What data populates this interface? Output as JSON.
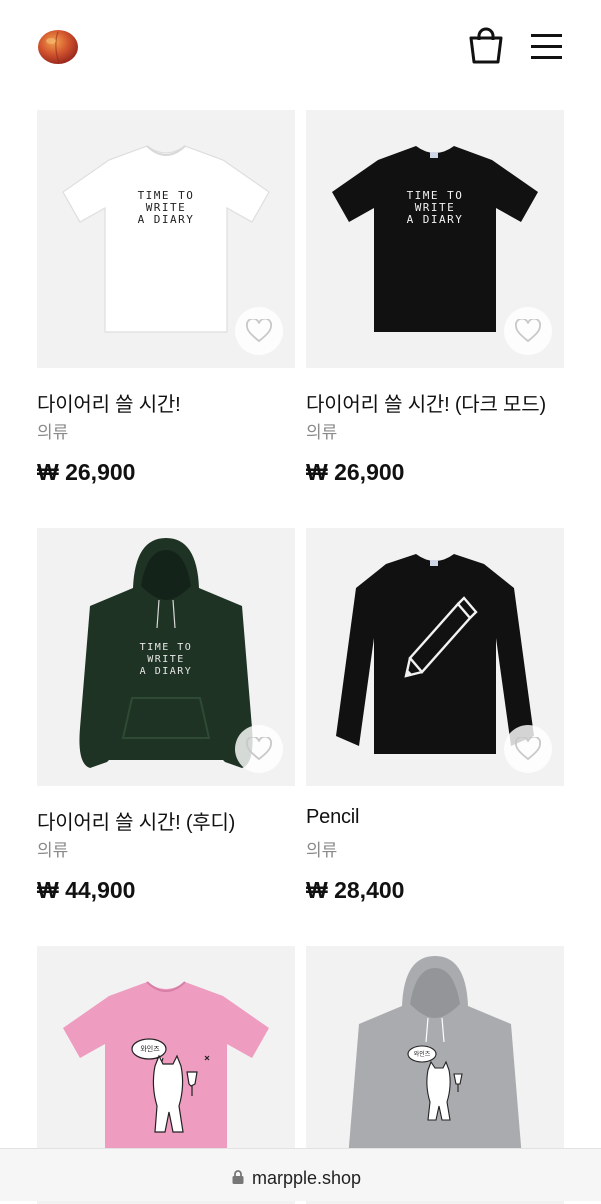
{
  "header": {
    "logo_icon": "peach-icon",
    "cart_icon": "shopping-bag-icon",
    "menu_icon": "hamburger-menu-icon"
  },
  "products": [
    {
      "name": "다이어리 쓸 시간!",
      "category": "의류",
      "price": "₩ 26,900",
      "print_text": [
        "TIME TO",
        "WRITE",
        "A DIARY"
      ],
      "garment": "t-shirt",
      "color": "#ffffff"
    },
    {
      "name": "다이어리 쓸 시간! (다크 모드)",
      "category": "의류",
      "price": "₩ 26,900",
      "print_text": [
        "TIME TO",
        "WRITE",
        "A DIARY"
      ],
      "garment": "t-shirt",
      "color": "#111111"
    },
    {
      "name": "다이어리 쓸 시간! (후디)",
      "category": "의류",
      "price": "₩ 44,900",
      "print_text": [
        "TIME TO",
        "WRITE",
        "A DIARY"
      ],
      "garment": "hoodie",
      "color": "#1f3324"
    },
    {
      "name": "Pencil",
      "category": "의류",
      "price": "₩ 28,400",
      "print_text": [],
      "garment": "long-sleeve",
      "color": "#111111"
    },
    {
      "name": "",
      "category": "",
      "price": "",
      "print_text": [
        "와인즈"
      ],
      "garment": "t-shirt",
      "color": "#ee9cc0"
    },
    {
      "name": "",
      "category": "",
      "price": "",
      "print_text": [
        "와인즈"
      ],
      "garment": "hoodie",
      "color": "#a9abae"
    }
  ],
  "urlbar": {
    "url": "marpple.shop",
    "lock_icon": "lock-icon"
  }
}
